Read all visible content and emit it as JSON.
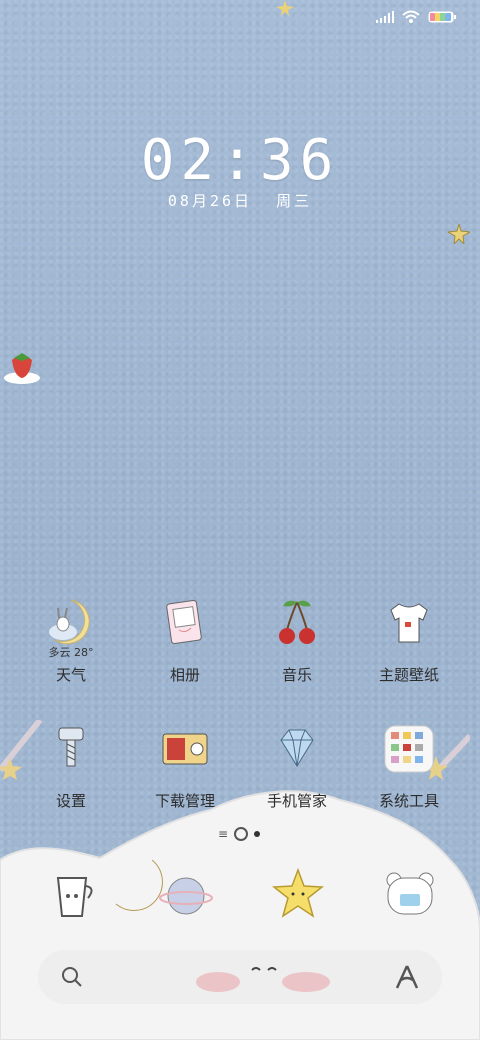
{
  "clock": {
    "time": "02:36"
  },
  "date": {
    "day": "08月26日",
    "weekday": "周三"
  },
  "weather": {
    "temp": "多云 28°"
  },
  "apps": [
    {
      "label": "天气",
      "icon": "moon-rabbit-icon"
    },
    {
      "label": "相册",
      "icon": "photo-icon"
    },
    {
      "label": "音乐",
      "icon": "cherry-icon"
    },
    {
      "label": "主题壁纸",
      "icon": "tshirt-icon"
    },
    {
      "label": "设置",
      "icon": "screw-icon"
    },
    {
      "label": "下载管理",
      "icon": "radio-icon"
    },
    {
      "label": "手机管家",
      "icon": "diamond-icon"
    },
    {
      "label": "系统工具",
      "icon": "tools-folder-icon"
    }
  ],
  "dock": [
    {
      "icon": "juice-cup-icon"
    },
    {
      "icon": "planet-icon"
    },
    {
      "icon": "star-icon"
    },
    {
      "icon": "bear-icon"
    }
  ],
  "colors": {
    "sky": "#9fb6d2",
    "cloud": "#f4f4f4",
    "text": "#2c2c2c"
  }
}
